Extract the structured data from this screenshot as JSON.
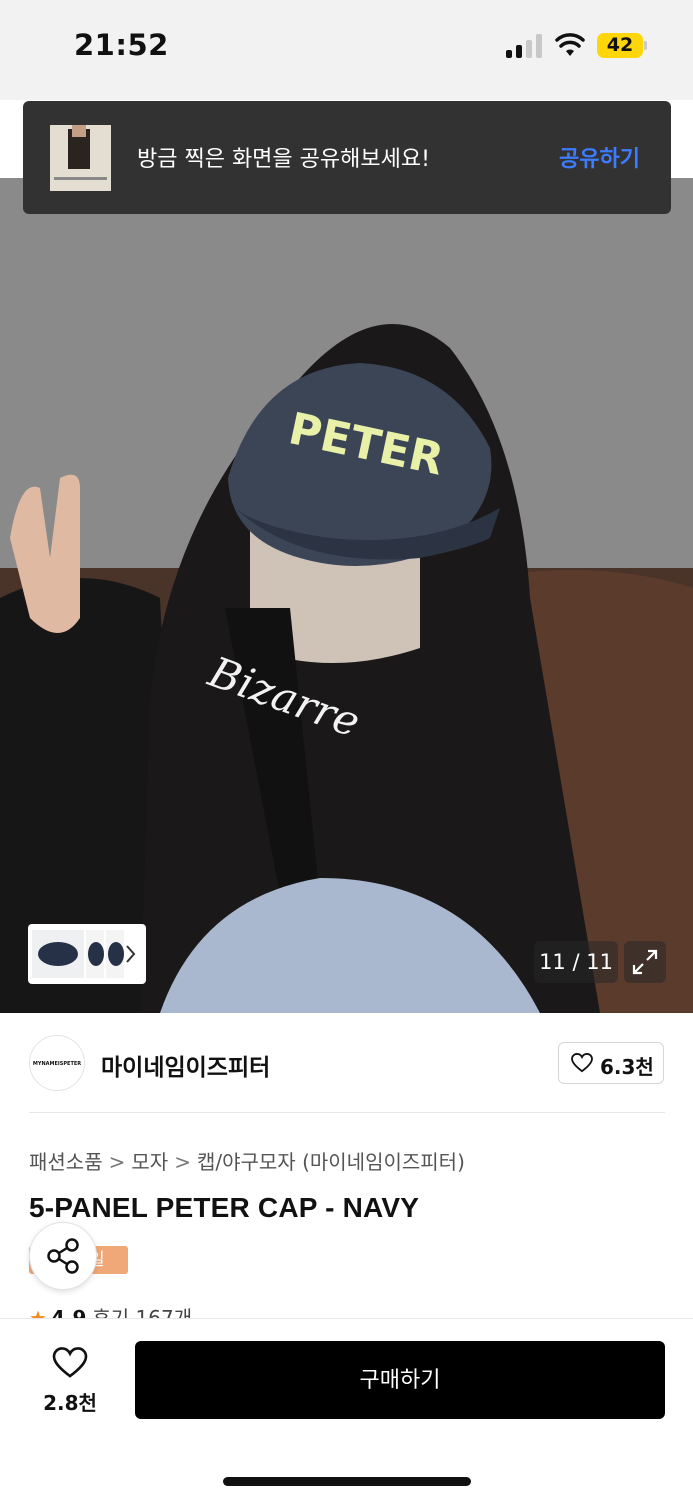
{
  "status_bar": {
    "time": "21:52",
    "battery": "42",
    "signal_bars_active": 2,
    "signal_bars_total": 4
  },
  "toast": {
    "message": "방금 찍은 화면을 공유해보세요!",
    "action_label": "공유하기"
  },
  "product_image": {
    "hat_text": "PETER",
    "hoodie_text": "Bizarre",
    "page_counter": "11 / 11"
  },
  "brand": {
    "name": "마이네임이즈피터",
    "logo_text": "MYNAMEISPETER",
    "likes": "6.3천"
  },
  "breadcrumb": {
    "items": [
      "패션소품",
      "모자",
      "캡/야구모자"
    ],
    "brand_suffix": "(마이네임이즈피터)"
  },
  "product": {
    "title": "5-PANEL PETER CAP - NAVY",
    "badge": "일",
    "rating": "4.9",
    "reviews": "후기 167개"
  },
  "bottom_bar": {
    "wish_count": "2.8천",
    "buy_label": "구매하기"
  },
  "colors": {
    "accent_link": "#3d7bff",
    "buy_button": "#000000",
    "badge": "#f0a878",
    "star": "#f08c1e",
    "battery": "#ffd60a"
  }
}
